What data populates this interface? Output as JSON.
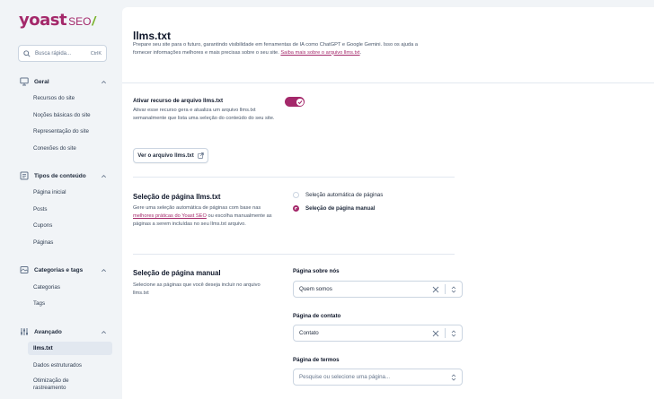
{
  "brand": {
    "name": "yoast",
    "product": "SEO",
    "slash": "/",
    "brand_color": "#a4286a",
    "accent_color": "#77b227"
  },
  "search": {
    "placeholder": "Busca rápida...",
    "shortcut": "CtrlK"
  },
  "sidebar": {
    "groups": [
      {
        "label": "Geral",
        "icon": "desktop-icon",
        "items": [
          "Recursos do site",
          "Noções básicas do site",
          "Representação do site",
          "Conexões do site"
        ]
      },
      {
        "label": "Tipos de conteúdo",
        "icon": "document-icon",
        "items": [
          "Página inicial",
          "Posts",
          "Cupons",
          "Páginas"
        ]
      },
      {
        "label": "Categorias e tags",
        "icon": "tags-icon",
        "items": [
          "Categorias",
          "Tags"
        ]
      },
      {
        "label": "Avançado",
        "icon": "sliders-icon",
        "items": [
          "llms.txt",
          "Dados estruturados",
          "Otimização de rastreamento"
        ]
      }
    ],
    "active_item": "llms.txt"
  },
  "page": {
    "title": "llms.txt",
    "description_1": "Prepare seu site para o futuro, garantindo visibilidade em ferramentas de IA como ChatGPT e Google Gemini. Isso os ajuda a fornecer informações melhores e mais precisas sobre o seu site.",
    "description_link": "Saiba mais sobre o arquivo llms.txt",
    "description_end": "."
  },
  "activate": {
    "title": "Ativar recurso de arquivo llms.txt",
    "description": "Ativar esse recurso gera e atualiza um arquivo llms.txt semanalmente que lista uma seleção do conteúdo do seu site.",
    "enabled": true,
    "view_button": "Ver o arquivo llms.txt"
  },
  "page_selection": {
    "title": "Seleção de página llms.txt",
    "desc_before": "Gere uma seleção automática de páginas com base nas ",
    "desc_link": "melhores práticas do Yoast SEO",
    "desc_after": " ou escolha manualmente as páginas a serem incluídas no seu llms.txt arquivo.",
    "options": [
      {
        "label": "Seleção automática de páginas",
        "selected": false
      },
      {
        "label": "Seleção de página manual",
        "selected": true
      }
    ]
  },
  "manual": {
    "title": "Seleção de página manual",
    "description": "Selecione as páginas que você deseja incluir no arquivo llms.txt",
    "fields": [
      {
        "label": "Página sobre nós",
        "value": "Quem somos"
      },
      {
        "label": "Página de contato",
        "value": "Contato"
      },
      {
        "label": "Página de termos",
        "placeholder": "Pesquise ou selecione uma página..."
      }
    ]
  }
}
